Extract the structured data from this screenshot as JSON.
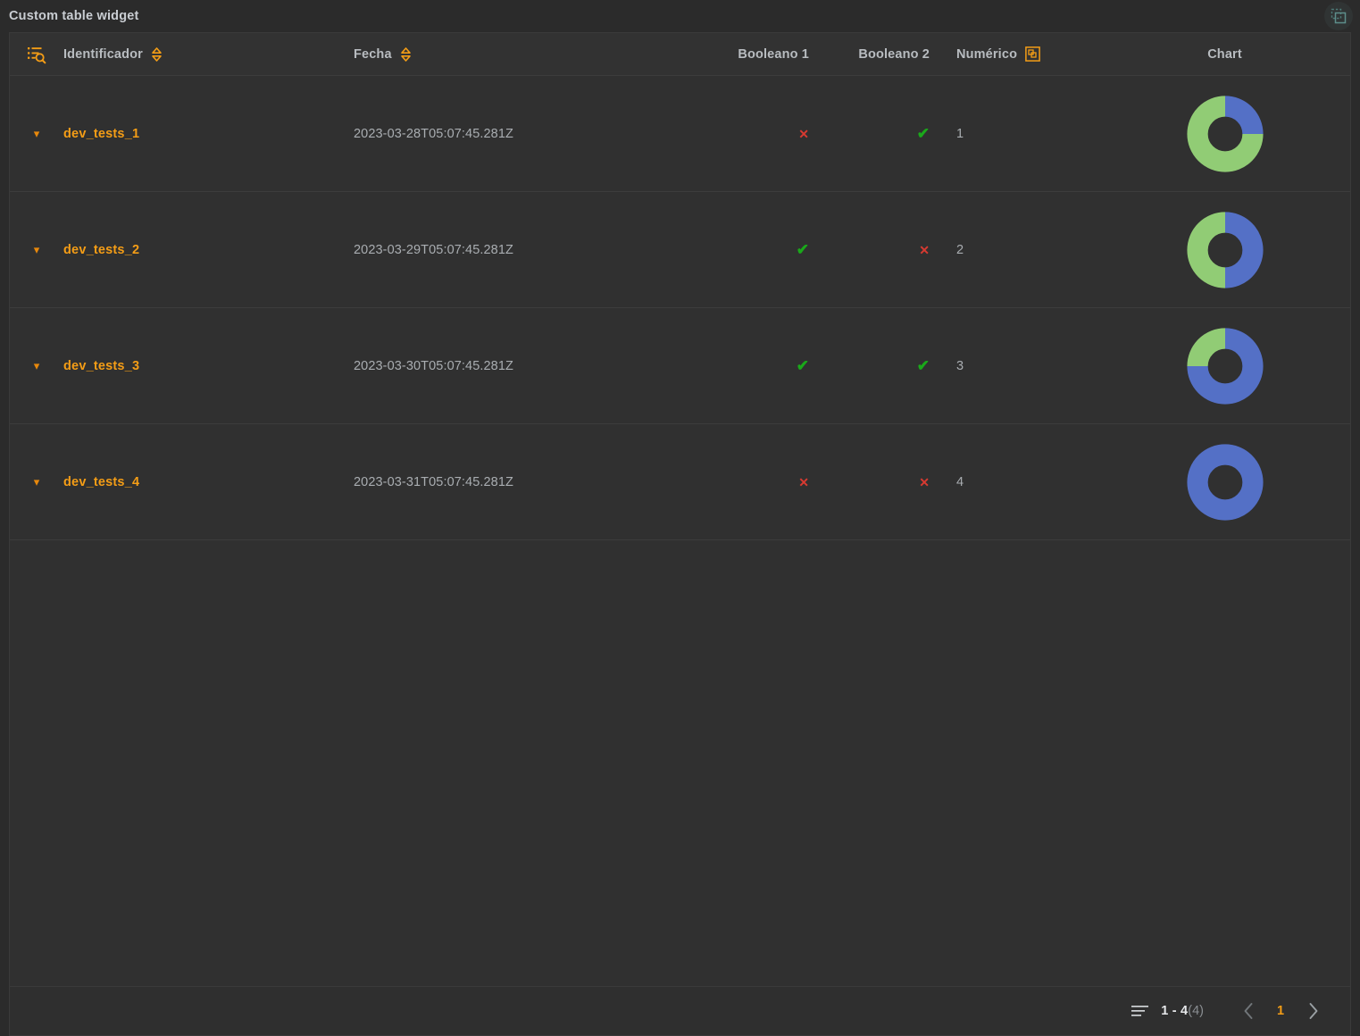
{
  "widget": {
    "title": "Custom table widget",
    "duplicate_icon": "copy-duplicate-icon",
    "accent_orange": "#f49d16",
    "background": "#2b2b2b",
    "surface": "#303030",
    "header_surface": "#323232"
  },
  "table": {
    "columns": [
      {
        "key": "expand",
        "label": "",
        "icon": "list-search-icon",
        "sortable": false
      },
      {
        "key": "id",
        "label": "Identificador",
        "icon": "sort-icon",
        "sortable": true
      },
      {
        "key": "fecha",
        "label": "Fecha",
        "icon": "sort-icon",
        "sortable": true
      },
      {
        "key": "bool1",
        "label": "Booleano 1",
        "icon": "",
        "sortable": false
      },
      {
        "key": "bool2",
        "label": "Booleano 2",
        "icon": "",
        "sortable": false
      },
      {
        "key": "num",
        "label": "Numérico",
        "icon": "aggregate-icon",
        "sortable": false
      },
      {
        "key": "chart",
        "label": "Chart",
        "icon": "",
        "sortable": false
      }
    ],
    "rows": [
      {
        "expander": "chevron-down-icon",
        "id": "dev_tests_1",
        "fecha": "2023-03-28T05:07:45.281Z",
        "bool1": false,
        "bool2": true,
        "num": "1",
        "bool1_glyph": "✕",
        "bool2_glyph": "✔",
        "chart": {
          "blue_pct": 25,
          "green_pct": 75
        }
      },
      {
        "expander": "chevron-down-icon",
        "id": "dev_tests_2",
        "fecha": "2023-03-29T05:07:45.281Z",
        "bool1": true,
        "bool2": false,
        "num": "2",
        "bool1_glyph": "✔",
        "bool2_glyph": "✕",
        "chart": {
          "blue_pct": 50,
          "green_pct": 50
        }
      },
      {
        "expander": "chevron-down-icon",
        "id": "dev_tests_3",
        "fecha": "2023-03-30T05:07:45.281Z",
        "bool1": true,
        "bool2": true,
        "num": "3",
        "bool1_glyph": "✔",
        "bool2_glyph": "✔",
        "chart": {
          "blue_pct": 75,
          "green_pct": 25
        }
      },
      {
        "expander": "chevron-down-icon",
        "id": "dev_tests_4",
        "fecha": "2023-03-31T05:07:45.281Z",
        "bool1": false,
        "bool2": false,
        "num": "4",
        "bool1_glyph": "✕",
        "bool2_glyph": "✕",
        "chart": {
          "blue_pct": 100,
          "green_pct": 0
        }
      }
    ]
  },
  "chart_data": {
    "type": "pie",
    "title": "Chart",
    "legend": [
      "Blue",
      "Green"
    ],
    "colors": {
      "blue": "#5470c6",
      "green": "#91cc75"
    },
    "donuts": [
      {
        "row": "dev_tests_1",
        "values": [
          25,
          75
        ]
      },
      {
        "row": "dev_tests_2",
        "values": [
          50,
          50
        ]
      },
      {
        "row": "dev_tests_3",
        "values": [
          75,
          25
        ]
      },
      {
        "row": "dev_tests_4",
        "values": [
          100,
          0
        ]
      }
    ]
  },
  "pagination": {
    "rows_icon": "rows-per-page-icon",
    "range": "1 - 4",
    "total": "(4)",
    "prev_icon": "chevron-left-icon",
    "next_icon": "chevron-right-icon",
    "current_page": "1"
  },
  "colors": {
    "true_green": "#1aa81a",
    "false_red": "#d83a31",
    "link_orange": "#f49d16",
    "text_gray": "#a9adb1",
    "header_gray": "#b8bcc0",
    "pie_blue": "#5470c6",
    "pie_green": "#91cc75"
  }
}
